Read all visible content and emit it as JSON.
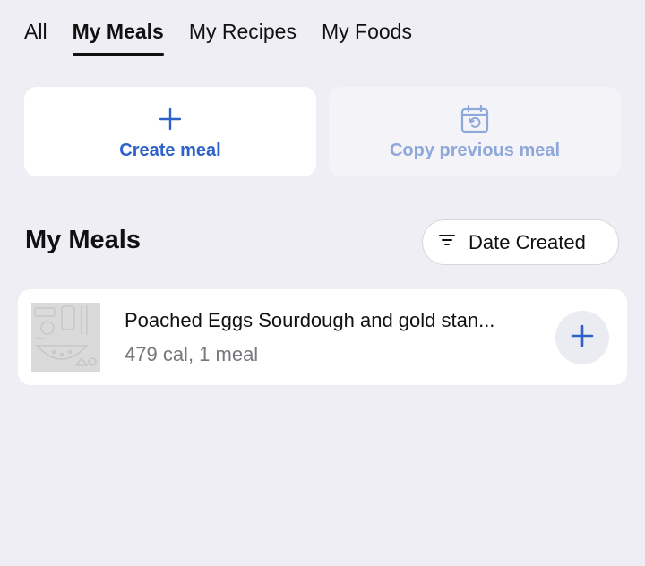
{
  "tabs": [
    {
      "label": "All",
      "active": false
    },
    {
      "label": "My Meals",
      "active": true
    },
    {
      "label": "My Recipes",
      "active": false
    },
    {
      "label": "My Foods",
      "active": false
    }
  ],
  "actions": {
    "create": {
      "label": "Create meal",
      "icon": "plus-icon"
    },
    "copy": {
      "label": "Copy previous meal",
      "icon": "calendar-repeat-icon"
    }
  },
  "section": {
    "title": "My Meals",
    "sort_label": "Date Created",
    "sort_icon": "filter-icon"
  },
  "meals": [
    {
      "title": "Poached Eggs Sourdough and gold stan...",
      "subtitle": "479 cal, 1 meal",
      "thumb_icon": "food-placeholder-icon",
      "add_icon": "plus-icon"
    }
  ],
  "colors": {
    "accent": "#2f62c8",
    "accent_disabled": "#8fa8da",
    "background": "#efeef4",
    "muted_text": "#77777c"
  }
}
